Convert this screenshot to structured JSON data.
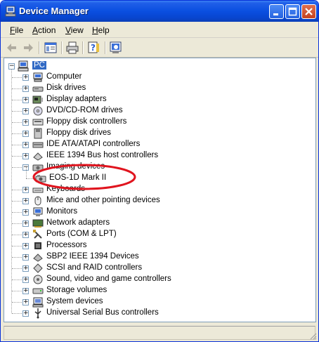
{
  "window": {
    "title": "Device Manager"
  },
  "menu": {
    "file": "File",
    "action": "Action",
    "view": "View",
    "help": "Help"
  },
  "tree": {
    "root": "PC",
    "items": [
      {
        "label": "Computer",
        "icon": "computer-icon"
      },
      {
        "label": "Disk drives",
        "icon": "disk-drive-icon"
      },
      {
        "label": "Display adapters",
        "icon": "display-adapter-icon"
      },
      {
        "label": "DVD/CD-ROM drives",
        "icon": "cd-drive-icon"
      },
      {
        "label": "Floppy disk controllers",
        "icon": "floppy-controller-icon"
      },
      {
        "label": "Floppy disk drives",
        "icon": "floppy-drive-icon"
      },
      {
        "label": "IDE ATA/ATAPI controllers",
        "icon": "ide-controller-icon"
      },
      {
        "label": "IEEE 1394 Bus host controllers",
        "icon": "ieee1394-icon"
      },
      {
        "label": "Imaging devices",
        "icon": "imaging-device-icon",
        "expanded": true
      },
      {
        "label": "EOS-1D Mark II",
        "icon": "camera-icon",
        "child": true
      },
      {
        "label": "Keyboards",
        "icon": "keyboard-icon"
      },
      {
        "label": "Mice and other pointing devices",
        "icon": "mouse-icon"
      },
      {
        "label": "Monitors",
        "icon": "monitor-icon"
      },
      {
        "label": "Network adapters",
        "icon": "network-adapter-icon"
      },
      {
        "label": "Ports (COM & LPT)",
        "icon": "port-icon"
      },
      {
        "label": "Processors",
        "icon": "processor-icon"
      },
      {
        "label": "SBP2 IEEE 1394 Devices",
        "icon": "sbp2-icon"
      },
      {
        "label": "SCSI and RAID controllers",
        "icon": "scsi-icon"
      },
      {
        "label": "Sound, video and game controllers",
        "icon": "sound-icon"
      },
      {
        "label": "Storage volumes",
        "icon": "storage-volume-icon"
      },
      {
        "label": "System devices",
        "icon": "system-device-icon"
      },
      {
        "label": "Universal Serial Bus controllers",
        "icon": "usb-icon"
      }
    ]
  },
  "colors": {
    "titlebar": "#0a4fe0",
    "highlight": "#316ac5",
    "annotation": "#e0141e"
  }
}
